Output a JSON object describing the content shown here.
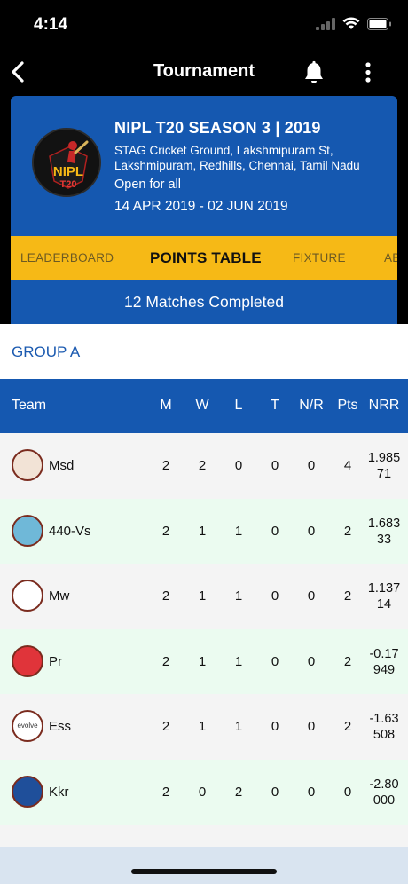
{
  "status": {
    "time": "4:14"
  },
  "nav": {
    "title": "Tournament"
  },
  "tournament": {
    "name": "NIPL T20 SEASON 3 | 2019",
    "venue": "STAG Cricket Ground, Lakshmipuram St, Lakshmipuram, Redhills, Chennai, Tamil Nadu",
    "entry": "Open for all",
    "dates": "14 APR 2019 - 02 JUN 2019",
    "logo_text_1": "NIPL",
    "logo_text_2": "T20"
  },
  "tabs": [
    {
      "label": "LEADERBOARD"
    },
    {
      "label": "POINTS TABLE",
      "active": true
    },
    {
      "label": "FIXTURE"
    },
    {
      "label": "AB"
    }
  ],
  "matches_completed": "12 Matches Completed",
  "group": {
    "title": "GROUP A"
  },
  "table": {
    "headers": {
      "team": "Team",
      "m": "M",
      "w": "W",
      "l": "L",
      "t": "T",
      "nr": "N/R",
      "pts": "Pts",
      "nrr": "NRR"
    },
    "rows": [
      {
        "team": "Msd",
        "m": "2",
        "w": "2",
        "l": "0",
        "t": "0",
        "nr": "0",
        "pts": "4",
        "nrr_1": "1.985",
        "nrr_2": "71",
        "badge_color": "#f2e3d6"
      },
      {
        "team": "440-Vs",
        "m": "2",
        "w": "1",
        "l": "1",
        "t": "0",
        "nr": "0",
        "pts": "2",
        "nrr_1": "1.683",
        "nrr_2": "33",
        "badge_color": "#6fb8d8"
      },
      {
        "team": "Mw",
        "m": "2",
        "w": "1",
        "l": "1",
        "t": "0",
        "nr": "0",
        "pts": "2",
        "nrr_1": "1.137",
        "nrr_2": "14",
        "badge_color": "#ffffff"
      },
      {
        "team": "Pr",
        "m": "2",
        "w": "1",
        "l": "1",
        "t": "0",
        "nr": "0",
        "pts": "2",
        "nrr_1": "-0.17",
        "nrr_2": "949",
        "badge_color": "#e0343a"
      },
      {
        "team": "Ess",
        "m": "2",
        "w": "1",
        "l": "1",
        "t": "0",
        "nr": "0",
        "pts": "2",
        "nrr_1": "-1.63",
        "nrr_2": "508",
        "badge_color": "#ffffff",
        "badge_text": "evolve"
      },
      {
        "team": "Kkr",
        "m": "2",
        "w": "0",
        "l": "2",
        "t": "0",
        "nr": "0",
        "pts": "0",
        "nrr_1": "-2.80",
        "nrr_2": "000",
        "badge_color": "#1f4f9a"
      }
    ]
  },
  "colors": {
    "primary": "#1558b0",
    "tab_bar": "#f6b916",
    "row_alt": "#ebfbf0"
  }
}
